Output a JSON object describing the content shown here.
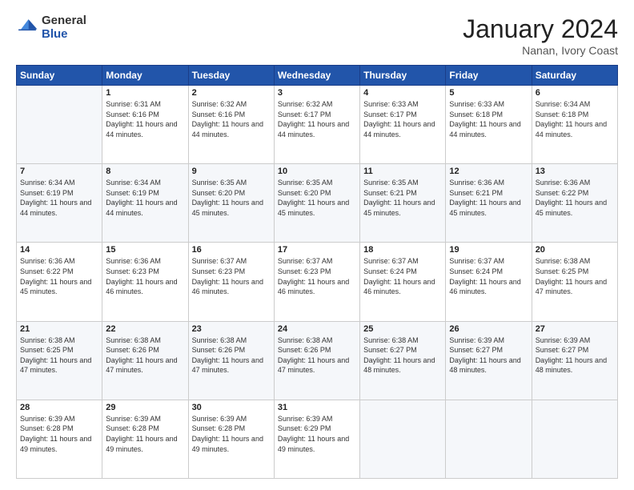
{
  "header": {
    "logo_general": "General",
    "logo_blue": "Blue",
    "month_title": "January 2024",
    "subtitle": "Nanan, Ivory Coast"
  },
  "weekdays": [
    "Sunday",
    "Monday",
    "Tuesday",
    "Wednesday",
    "Thursday",
    "Friday",
    "Saturday"
  ],
  "weeks": [
    [
      {
        "day": "",
        "sunrise": "",
        "sunset": "",
        "daylight": ""
      },
      {
        "day": "1",
        "sunrise": "6:31 AM",
        "sunset": "6:16 PM",
        "daylight": "11 hours and 44 minutes."
      },
      {
        "day": "2",
        "sunrise": "6:32 AM",
        "sunset": "6:16 PM",
        "daylight": "11 hours and 44 minutes."
      },
      {
        "day": "3",
        "sunrise": "6:32 AM",
        "sunset": "6:17 PM",
        "daylight": "11 hours and 44 minutes."
      },
      {
        "day": "4",
        "sunrise": "6:33 AM",
        "sunset": "6:17 PM",
        "daylight": "11 hours and 44 minutes."
      },
      {
        "day": "5",
        "sunrise": "6:33 AM",
        "sunset": "6:18 PM",
        "daylight": "11 hours and 44 minutes."
      },
      {
        "day": "6",
        "sunrise": "6:34 AM",
        "sunset": "6:18 PM",
        "daylight": "11 hours and 44 minutes."
      }
    ],
    [
      {
        "day": "7",
        "sunrise": "6:34 AM",
        "sunset": "6:19 PM",
        "daylight": "11 hours and 44 minutes."
      },
      {
        "day": "8",
        "sunrise": "6:34 AM",
        "sunset": "6:19 PM",
        "daylight": "11 hours and 44 minutes."
      },
      {
        "day": "9",
        "sunrise": "6:35 AM",
        "sunset": "6:20 PM",
        "daylight": "11 hours and 45 minutes."
      },
      {
        "day": "10",
        "sunrise": "6:35 AM",
        "sunset": "6:20 PM",
        "daylight": "11 hours and 45 minutes."
      },
      {
        "day": "11",
        "sunrise": "6:35 AM",
        "sunset": "6:21 PM",
        "daylight": "11 hours and 45 minutes."
      },
      {
        "day": "12",
        "sunrise": "6:36 AM",
        "sunset": "6:21 PM",
        "daylight": "11 hours and 45 minutes."
      },
      {
        "day": "13",
        "sunrise": "6:36 AM",
        "sunset": "6:22 PM",
        "daylight": "11 hours and 45 minutes."
      }
    ],
    [
      {
        "day": "14",
        "sunrise": "6:36 AM",
        "sunset": "6:22 PM",
        "daylight": "11 hours and 45 minutes."
      },
      {
        "day": "15",
        "sunrise": "6:36 AM",
        "sunset": "6:23 PM",
        "daylight": "11 hours and 46 minutes."
      },
      {
        "day": "16",
        "sunrise": "6:37 AM",
        "sunset": "6:23 PM",
        "daylight": "11 hours and 46 minutes."
      },
      {
        "day": "17",
        "sunrise": "6:37 AM",
        "sunset": "6:23 PM",
        "daylight": "11 hours and 46 minutes."
      },
      {
        "day": "18",
        "sunrise": "6:37 AM",
        "sunset": "6:24 PM",
        "daylight": "11 hours and 46 minutes."
      },
      {
        "day": "19",
        "sunrise": "6:37 AM",
        "sunset": "6:24 PM",
        "daylight": "11 hours and 46 minutes."
      },
      {
        "day": "20",
        "sunrise": "6:38 AM",
        "sunset": "6:25 PM",
        "daylight": "11 hours and 47 minutes."
      }
    ],
    [
      {
        "day": "21",
        "sunrise": "6:38 AM",
        "sunset": "6:25 PM",
        "daylight": "11 hours and 47 minutes."
      },
      {
        "day": "22",
        "sunrise": "6:38 AM",
        "sunset": "6:26 PM",
        "daylight": "11 hours and 47 minutes."
      },
      {
        "day": "23",
        "sunrise": "6:38 AM",
        "sunset": "6:26 PM",
        "daylight": "11 hours and 47 minutes."
      },
      {
        "day": "24",
        "sunrise": "6:38 AM",
        "sunset": "6:26 PM",
        "daylight": "11 hours and 47 minutes."
      },
      {
        "day": "25",
        "sunrise": "6:38 AM",
        "sunset": "6:27 PM",
        "daylight": "11 hours and 48 minutes."
      },
      {
        "day": "26",
        "sunrise": "6:39 AM",
        "sunset": "6:27 PM",
        "daylight": "11 hours and 48 minutes."
      },
      {
        "day": "27",
        "sunrise": "6:39 AM",
        "sunset": "6:27 PM",
        "daylight": "11 hours and 48 minutes."
      }
    ],
    [
      {
        "day": "28",
        "sunrise": "6:39 AM",
        "sunset": "6:28 PM",
        "daylight": "11 hours and 49 minutes."
      },
      {
        "day": "29",
        "sunrise": "6:39 AM",
        "sunset": "6:28 PM",
        "daylight": "11 hours and 49 minutes."
      },
      {
        "day": "30",
        "sunrise": "6:39 AM",
        "sunset": "6:28 PM",
        "daylight": "11 hours and 49 minutes."
      },
      {
        "day": "31",
        "sunrise": "6:39 AM",
        "sunset": "6:29 PM",
        "daylight": "11 hours and 49 minutes."
      },
      {
        "day": "",
        "sunrise": "",
        "sunset": "",
        "daylight": ""
      },
      {
        "day": "",
        "sunrise": "",
        "sunset": "",
        "daylight": ""
      },
      {
        "day": "",
        "sunrise": "",
        "sunset": "",
        "daylight": ""
      }
    ]
  ]
}
